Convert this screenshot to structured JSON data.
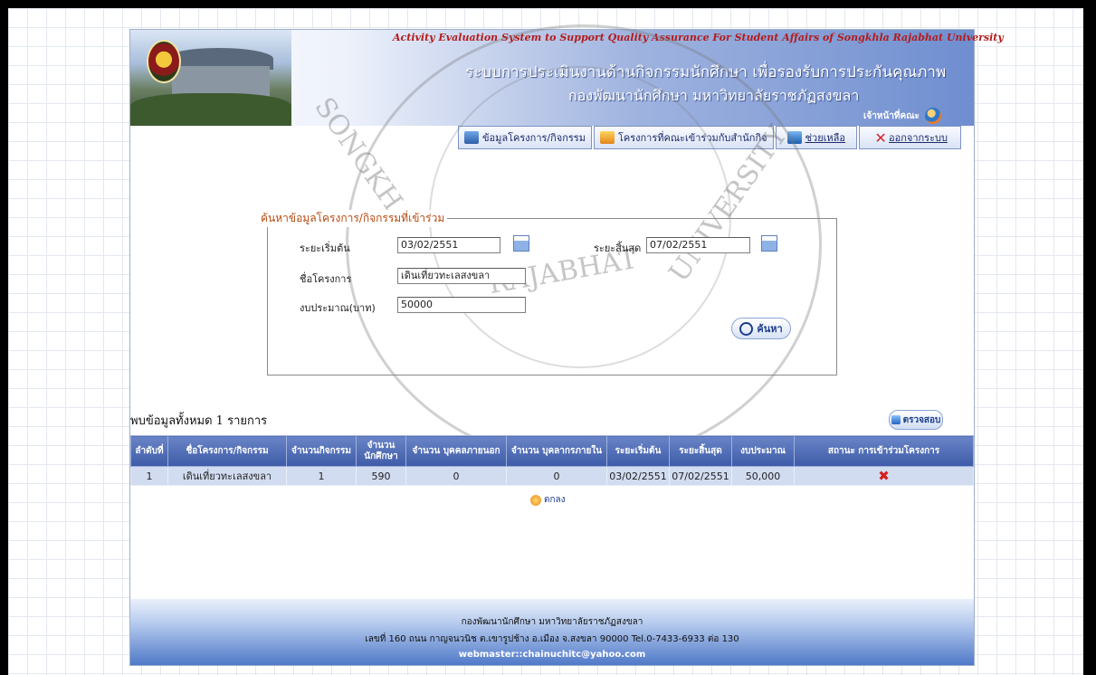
{
  "header": {
    "english_title": "Activity Evaluation System to Support Quality Assurance For Student Affairs of Songkhla Rajabhat University",
    "thai_title_line1": "ระบบการประเมินงานด้านกิจกรรมนักศึกษา   เพื่อรองรับการประกันคุณภาพ",
    "thai_title_line2": "กองพัฒนานักศึกษา   มหาวิทยาลัยราชภัฏสงขลา",
    "user_role": "เจ้าหน้าที่คณะ"
  },
  "menu": [
    {
      "label": "ข้อมูลโครงการ/กิจกรรม",
      "icon": "database-icon"
    },
    {
      "label": "โครงการที่คณะเข้าร่วมกับสำนักกิจ",
      "icon": "star-icon"
    },
    {
      "label": "ช่วยเหลือ",
      "icon": "help-icon"
    },
    {
      "label": "ออกจากระบบ",
      "icon": "close-icon"
    }
  ],
  "search": {
    "legend": "ค้นหาข้อมูลโครงการ/กิจกรรมที่เข้าร่วม",
    "start_label": "ระยะเริ่มต้น",
    "start_value": "03/02/2551",
    "end_label": "ระยะสิ้นสุด",
    "end_value": "07/02/2551",
    "name_label": "ชื่อโครงการ",
    "name_value": "เดินเที่ยวทะเลสงขลา",
    "budget_label": "งบประมาณ(บาท)",
    "budget_value": "50000",
    "button_label": "ค้นหา"
  },
  "results": {
    "found_text": "พบข้อมูลทั้งหมด 1 รายการ",
    "check_button": "ตรวจสอบ",
    "columns": [
      "ลำดับที่",
      "ชื่อโครงการ/กิจกรรม",
      "จำนวนกิจกรรม",
      "จำนวน นักศึกษา",
      "จำนวน บุคคลภายนอก",
      "จำนวน บุคลากรภายใน",
      "ระยะเริ่มต้น",
      "ระยะสิ้นสุด",
      "งบประมาณ",
      "สถานะ การเข้าร่วมโครงการ"
    ],
    "rows": [
      [
        "1",
        "เดินเที่ยวทะเลสงขลา",
        "1",
        "590",
        "0",
        "0",
        "03/02/2551",
        "07/02/2551",
        "50,000"
      ]
    ],
    "ok_button": "ตกลง"
  },
  "watermark": {
    "text_left": "SONGKH",
    "text_right": "UNIVERSITY",
    "text_bottom": "RAJABHAT"
  },
  "footer": {
    "line1": "กองพัฒนานักศึกษา มหาวิทยาลัยราชภัฏสงขลา",
    "line2": "เลขที่ 160 ถนน กาญจนวนิช ต.เขารูปช้าง อ.เมือง จ.สงขลา 90000 Tel.0-7433-6933 ต่อ 130",
    "line3": "webmaster::chainuchitc@yahoo.com"
  }
}
